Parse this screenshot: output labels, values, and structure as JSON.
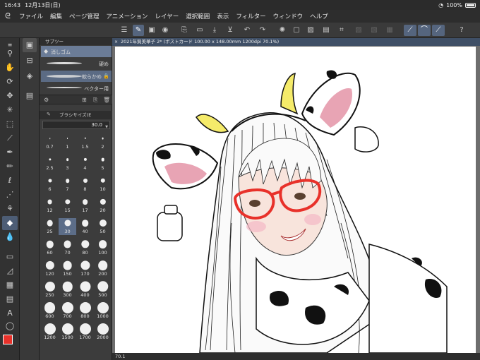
{
  "status_bar": {
    "time": "16:43",
    "date": "12月13日(日)",
    "battery": "100%"
  },
  "menu": {
    "items": [
      "ファイル",
      "編集",
      "ページ管理",
      "アニメーション",
      "レイヤー",
      "選択範囲",
      "表示",
      "フィルター",
      "ウィンドウ",
      "ヘルプ"
    ]
  },
  "document": {
    "tab_title": "2021年賀美華子 2* (ポストカード 100.00 x 148.00mm 1200dpi 70.1%)",
    "zoom": "70.1"
  },
  "subtool": {
    "header": "サブツー",
    "items": [
      {
        "label": "消しゴム",
        "selected": true
      },
      {
        "label": "硬め",
        "selected": false
      },
      {
        "label": "軟らかめ",
        "selected": true
      },
      {
        "label": "ベクター用",
        "selected": false
      }
    ]
  },
  "brush_size": {
    "header": "ブラシサイズ(E",
    "value": "30.0",
    "sizes": [
      "0.7",
      "1",
      "1.5",
      "2",
      "2.5",
      "3",
      "4",
      "5",
      "6",
      "7",
      "8",
      "10",
      "12",
      "15",
      "17",
      "20",
      "25",
      "30",
      "40",
      "50",
      "60",
      "70",
      "80",
      "100",
      "120",
      "150",
      "170",
      "200",
      "250",
      "300",
      "400",
      "500",
      "600",
      "700",
      "800",
      "1000",
      "1200",
      "1500",
      "1700",
      "2000"
    ],
    "selected": "30"
  },
  "tools": {
    "icons": [
      "menu-icon",
      "magnifier-icon",
      "hand-icon",
      "rotate-icon",
      "move-icon",
      "auto-select-icon",
      "selection-icon",
      "eyedropper-icon",
      "pen-icon",
      "pencil-icon",
      "brush-icon",
      "airbrush-icon",
      "decoration-icon",
      "eraser-icon",
      "blend-icon",
      "fill-icon",
      "figure-icon",
      "frame-icon",
      "gradient-icon",
      "text-icon",
      "balloon-icon"
    ],
    "selected": "eraser-icon"
  },
  "colors": {
    "main": "#e8312a",
    "sub": "#4a78b8"
  }
}
